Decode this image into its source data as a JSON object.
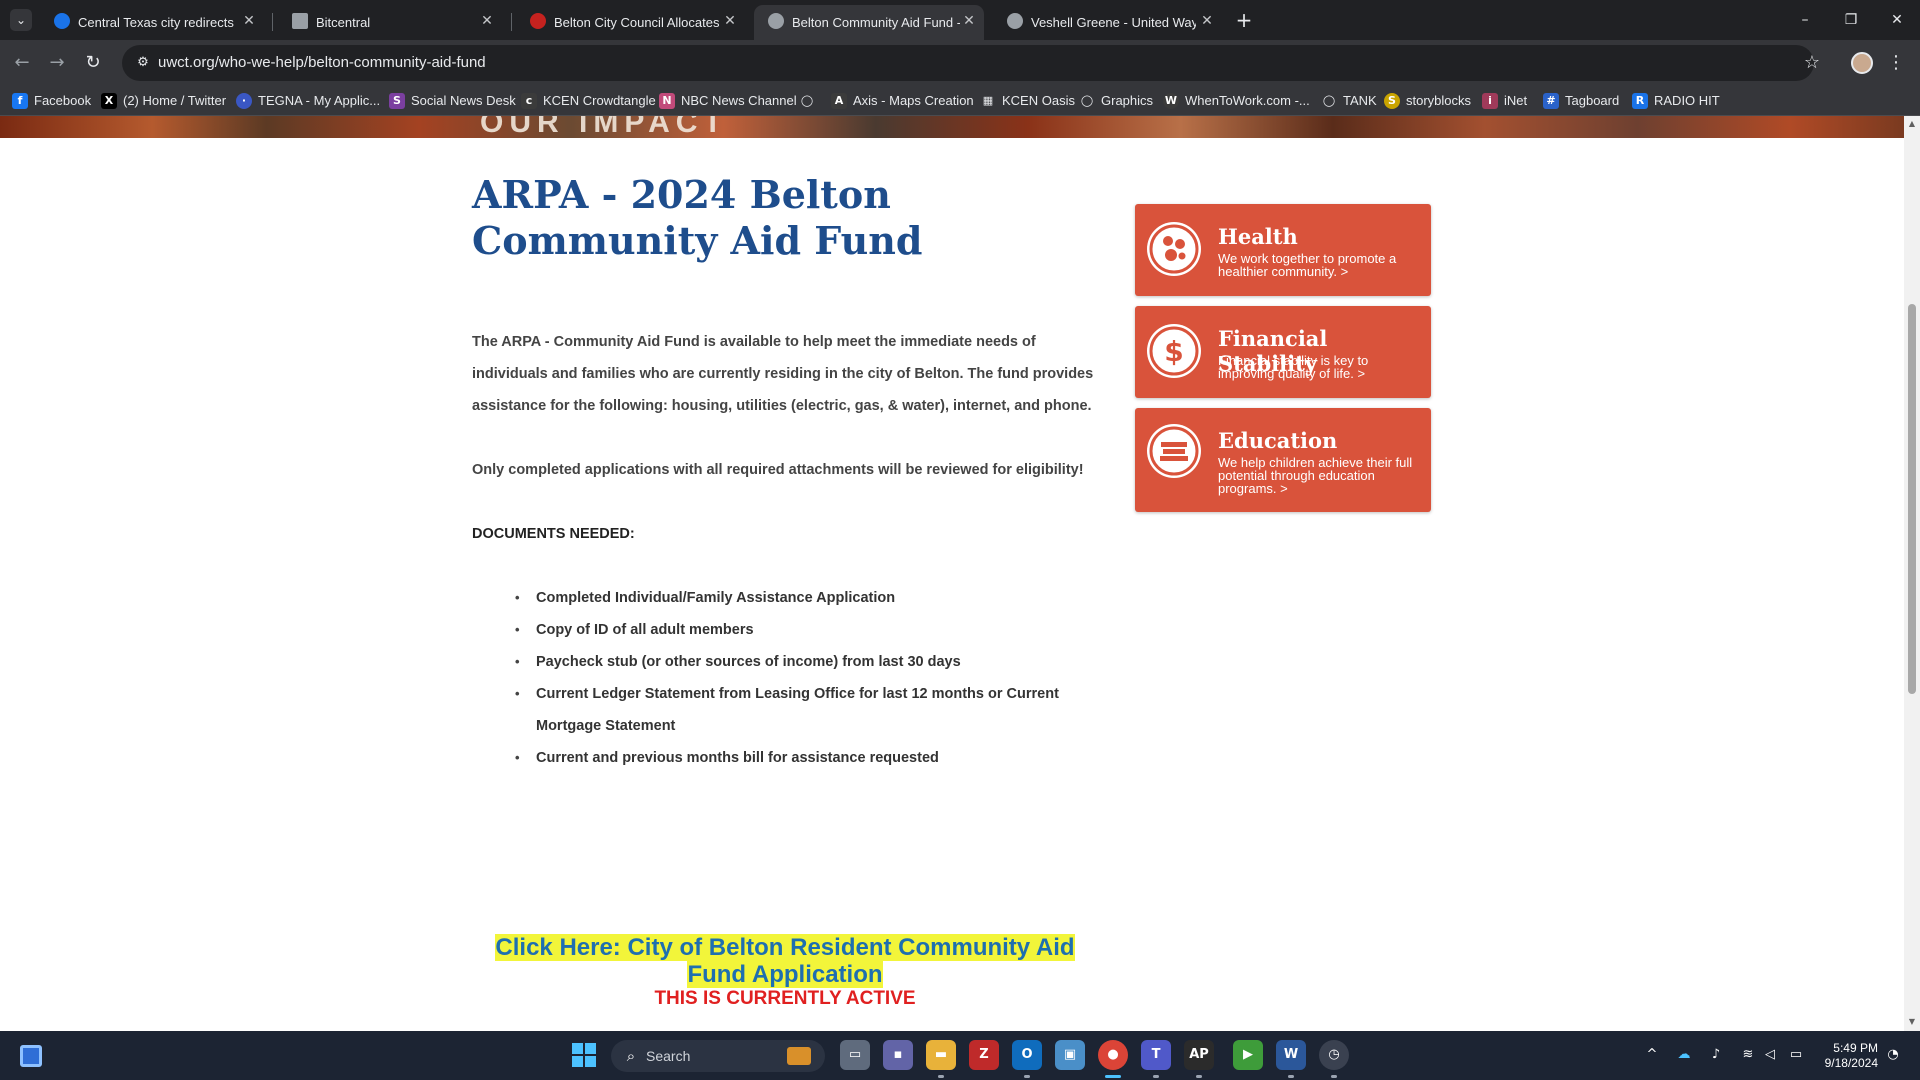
{
  "browser": {
    "tabs": [
      {
        "title": "Central Texas city redirects COV",
        "favicon_color": "#1a73e8",
        "active": false
      },
      {
        "title": "Bitcentral",
        "favicon_color": "#9aa0a6",
        "active": false
      },
      {
        "title": "Belton City Council Allocates Re",
        "favicon_color": "#c5221f",
        "active": false
      },
      {
        "title": "Belton Community Aid Fund - U",
        "favicon_color": "#9aa0a6",
        "active": true
      },
      {
        "title": "Veshell Greene - United Way of",
        "favicon_color": "#9aa0a6",
        "active": false
      }
    ],
    "url": "uwct.org/who-we-help/belton-community-aid-fund",
    "bookmarks": [
      {
        "label": "Facebook",
        "icon": "facebook-icon",
        "color": "#1877f2",
        "glyph": "f"
      },
      {
        "label": "(2) Home / Twitter",
        "icon": "x-icon",
        "color": "#000000",
        "glyph": "X"
      },
      {
        "label": "TEGNA - My Applic...",
        "icon": "tegna-icon",
        "color": "#3a57c4",
        "glyph": "·"
      },
      {
        "label": "Social News Desk",
        "icon": "snd-icon",
        "color": "#7b3fa0",
        "glyph": "S"
      },
      {
        "label": "KCEN Crowdtangle",
        "icon": "crowdtangle-icon",
        "color": "#3b3b3b",
        "glyph": "c"
      },
      {
        "label": "NBC News Channel",
        "icon": "nbc-icon",
        "color": "#c24a7a",
        "glyph": "N"
      },
      {
        "label": "",
        "icon": "globe-icon",
        "color": "#5f6368",
        "glyph": "◯"
      },
      {
        "label": "Axis - Maps Creation",
        "icon": "axis-icon",
        "color": "#3b3b3b",
        "glyph": "A"
      },
      {
        "label": "KCEN Oasis",
        "icon": "grid-icon",
        "color": "#5f6368",
        "glyph": "▦"
      },
      {
        "label": "Graphics",
        "icon": "globe-icon",
        "color": "#5f6368",
        "glyph": "◯"
      },
      {
        "label": "WhenToWork.com -...",
        "icon": "w-icon",
        "color": "#3b3b3b",
        "glyph": "W"
      },
      {
        "label": "TANK",
        "icon": "globe-icon",
        "color": "#5f6368",
        "glyph": "◯"
      },
      {
        "label": "storyblocks",
        "icon": "storyblocks-icon",
        "color": "#c9a400",
        "glyph": "S"
      },
      {
        "label": "iNet",
        "icon": "inet-icon",
        "color": "#a03a5a",
        "glyph": "i"
      },
      {
        "label": "Tagboard",
        "icon": "tagboard-icon",
        "color": "#2a62c9",
        "glyph": "#"
      },
      {
        "label": "RADIO HIT",
        "icon": "radiohit-icon",
        "color": "#1a73e8",
        "glyph": "R"
      }
    ]
  },
  "page": {
    "hero_partial_text": "OUR IMPACT",
    "title": "ARPA - 2024 Belton Community Aid Fund",
    "intro": "The ARPA - Community Aid Fund is available to help meet the immediate needs of individuals and families who are currently residing in the city of Belton. The fund provides assistance for the following: housing, utilities (electric, gas, & water), internet, and phone.",
    "notice": "Only completed applications with all required attachments will be reviewed for eligibility!",
    "documents_title": "DOCUMENTS NEEDED:",
    "documents": [
      "Completed Individual/Family Assistance Application",
      "Copy of ID of all adult members",
      "Paycheck stub (or other sources of income) from last 30 days",
      "Current Ledger Statement from Leasing Office for last 12 months or Current Mortgage Statement",
      "Current and previous months bill for assistance requested"
    ],
    "cta_link": "Click Here: City of Belton Resident Community Aid Fund Application",
    "cta_status": "THIS IS CURRENTLY ACTIVE",
    "cards": [
      {
        "title": "Health",
        "desc": "We work together to promote a healthier community. >",
        "icon": "health-icon"
      },
      {
        "title": "Financial Stability",
        "desc": "Financial stability is key to improving quality of life. >",
        "icon": "dollar-icon"
      },
      {
        "title": "Education",
        "desc": "We help children achieve their full potential through education programs. >",
        "icon": "book-icon"
      }
    ],
    "accent_color": "#d9533b",
    "title_color": "#1e4d8c"
  },
  "taskbar": {
    "search_placeholder": "Search",
    "time": "5:49 PM",
    "date": "9/18/2024"
  }
}
